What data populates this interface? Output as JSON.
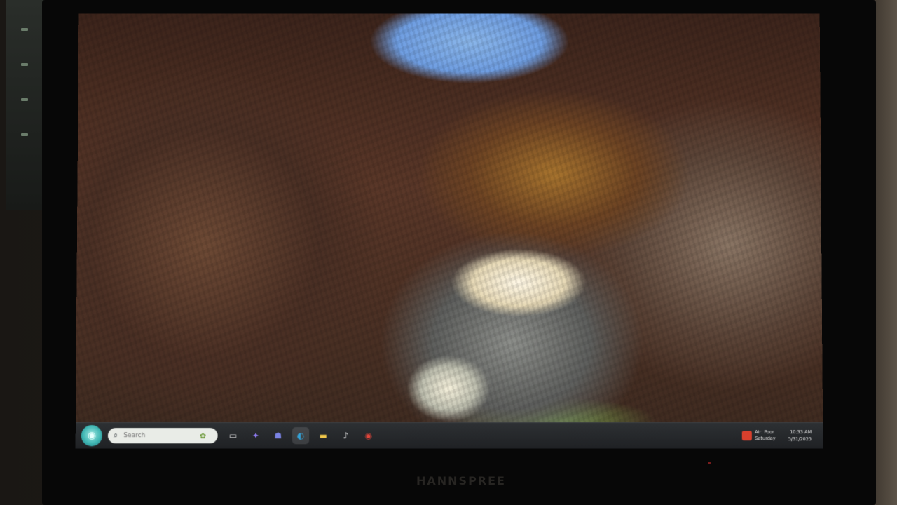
{
  "taskbar": {
    "search": {
      "placeholder": "Search"
    },
    "apps": [
      {
        "name": "task-view",
        "glyph": "▭"
      },
      {
        "name": "copilot",
        "glyph": "✦",
        "color": "#6f7dfc"
      },
      {
        "name": "teams",
        "glyph": "☗",
        "color": "#7a83e4"
      },
      {
        "name": "edge",
        "glyph": "◐",
        "color": "#34a3d9"
      },
      {
        "name": "file-explorer",
        "glyph": "▬",
        "color": "#f2c84b"
      },
      {
        "name": "tiktok",
        "glyph": "♪",
        "color": "#ffffff"
      },
      {
        "name": "chrome",
        "glyph": "◉",
        "color": "#e2453a"
      }
    ],
    "weather": {
      "line1": "Air: Poor",
      "line2": "Saturday"
    },
    "clock": {
      "time": "10:33 AM",
      "date": "5/31/2025"
    }
  },
  "monitor": {
    "brand": "HANNSPREE"
  },
  "colors": {
    "taskbar_bg": "#25282b",
    "start_accent": "#3fb6b3"
  }
}
